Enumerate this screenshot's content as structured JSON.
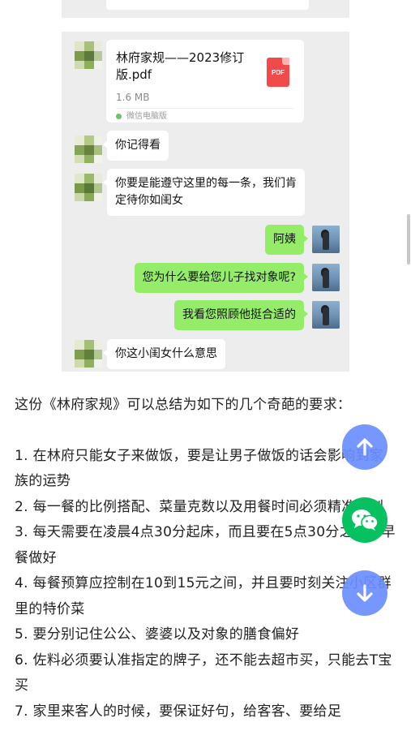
{
  "chat": {
    "file": {
      "name": "林府家规——2023修订版.pdf",
      "size": "1.6 MB",
      "source": "微信电脑版",
      "icon_label": "PDF"
    },
    "messages": [
      {
        "side": "in",
        "text": "你记得看"
      },
      {
        "side": "in",
        "text": "你要是能遵守这里的每一条，我们肯定待你如闺女"
      },
      {
        "side": "out",
        "text": "阿姨"
      },
      {
        "side": "out",
        "text": "您为什么要给您儿子找对象呢?"
      },
      {
        "side": "out",
        "text": "我看您照顾他挺合适的"
      },
      {
        "side": "in",
        "text": "你这小闺女什么意思"
      }
    ]
  },
  "article": {
    "intro": "这份《林府家规》可以总结为如下的几个奇葩的要求：",
    "items": [
      "1. 在林府只能女子来做饭，要是让男子做饭的话会影响到家族的运势",
      "2. 每一餐的比例搭配、菜量克数以及用餐时间必须精准控制",
      "3. 每天需要在凌晨4点30分起床，而且要在5点30分之前把早餐做好",
      "4. 每餐预算应控制在10到15元之间，并且要时刻关注小区群里的特价菜",
      "5. 要分别记住公公、婆婆以及对象的膳食偏好",
      "6. 佐料必须要认准指定的牌子，还不能去超市买，只能去T宝买",
      "7. 家里来客人的时候，要保证好句，给客客、要给足"
    ]
  },
  "buttons": {
    "scroll_top": "arrow-up-icon",
    "wechat": "wechat-icon",
    "scroll_down": "arrow-down-icon"
  },
  "colors": {
    "chat_bg": "#ededed",
    "out_bubble": "#95ec69",
    "fab_blue": "#6b8fff",
    "fab_green": "#07c160",
    "pdf_red": "#f04a4a"
  }
}
